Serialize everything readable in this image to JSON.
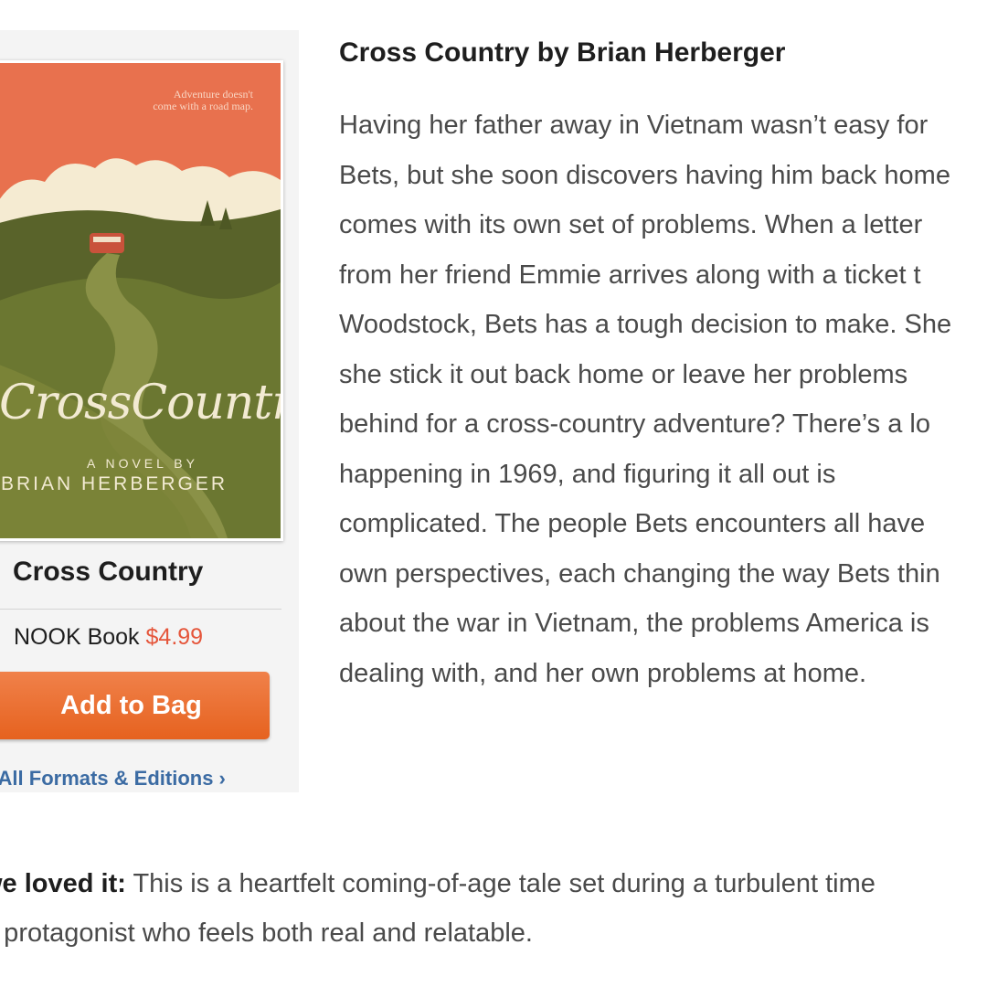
{
  "article": {
    "heading": "Cross Country by Brian Herberger",
    "synopsis_lines": [
      "Having her father away in Vietnam wasn’t easy for",
      "Bets, but she soon discovers having him back home",
      "comes with its own set of problems. When a letter",
      "from her friend Emmie arrives along with a ticket t",
      "Woodstock, Bets has a tough decision to make. She",
      "she stick it out back home or leave her problems",
      "behind for a cross-country adventure? There’s a lo",
      "happening in 1969, and figuring it all out is",
      "complicated. The people Bets encounters all have",
      "own perspectives, each changing the way Bets thin",
      "about the war in Vietnam, the problems America is",
      "dealing with, and her own problems at home."
    ]
  },
  "product": {
    "cover": {
      "tagline": "Adventure doesn't come with a road map.",
      "script_title": "CrossCountry",
      "novel_by": "A NOVEL BY",
      "author_caps": "BRIAN HERBERGER"
    },
    "title": "Cross Country",
    "format": "NOOK Book",
    "price": "$4.99",
    "add_button": "Add to Bag",
    "formats_link": "e All Formats & Editions ›"
  },
  "review": {
    "label": " we loved it:",
    "text_line1": " This is a heartfelt coming-of-age tale set during a turbulent time",
    "text_line2": " a protagonist who feels both real and relatable."
  },
  "colors": {
    "price": "#e5553a",
    "button": "#e6621f",
    "link": "#3b6ba3",
    "cover_sky": "#e8714e",
    "cover_hills": "#5f6a2c"
  }
}
